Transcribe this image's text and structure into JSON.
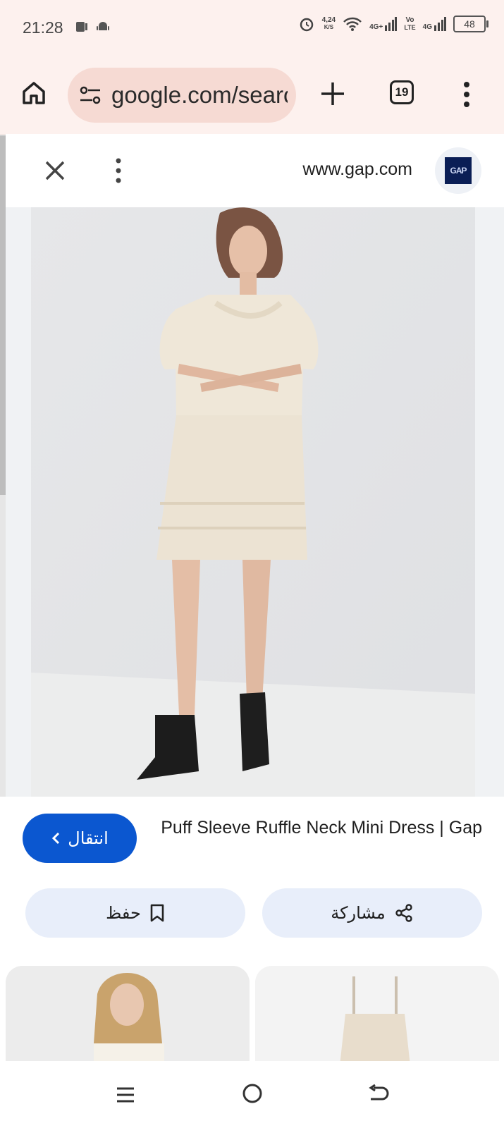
{
  "status_bar": {
    "time": "21:28",
    "net_speed_top": "4,24",
    "net_speed_unit": "K/S",
    "sim1_label": "4G+",
    "volte_top": "Vo",
    "volte_bottom": "LTE",
    "sim2_label": "4G",
    "battery": "48",
    "icons": [
      "screen-record-icon",
      "android-icon",
      "alarm-icon",
      "wifi-icon",
      "signal-icon",
      "battery-icon"
    ]
  },
  "browser": {
    "url": "google.com/search",
    "tab_count": "19",
    "icons": [
      "home-icon",
      "site-settings-icon",
      "plus-icon",
      "tabs-icon",
      "more-vert-icon"
    ]
  },
  "result_sheet": {
    "domain": "www.gap.com",
    "favicon_text": "GAP",
    "product_title": "Puff Sleeve Ruffle Neck Mini Dress | Gap",
    "go_button": "انتقال",
    "share_button": "مشاركة",
    "save_button": "حفظ"
  },
  "colors": {
    "browser_bg": "#fdf1ee",
    "url_pill": "#f6dad3",
    "primary": "#0b57d0",
    "chip_bg": "#e8eefa"
  }
}
